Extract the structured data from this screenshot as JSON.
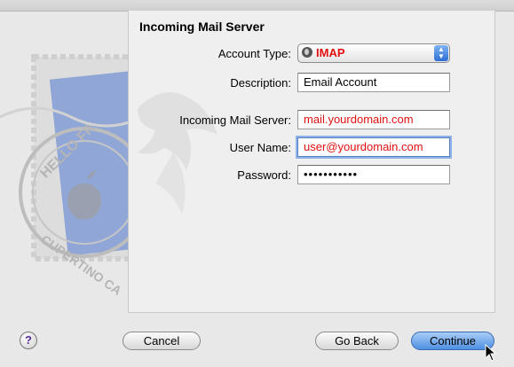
{
  "panel": {
    "title": "Incoming Mail Server"
  },
  "form": {
    "account_type": {
      "label": "Account Type:",
      "value": "IMAP"
    },
    "description": {
      "label": "Description:",
      "value": "Email Account"
    },
    "incoming_server": {
      "label": "Incoming Mail Server:",
      "value": "mail.yourdomain.com"
    },
    "user_name": {
      "label": "User Name:",
      "value": "user@yourdomain.com"
    },
    "password": {
      "label": "Password:",
      "value": "•••••••••••"
    }
  },
  "buttons": {
    "help": "?",
    "cancel": "Cancel",
    "go_back": "Go Back",
    "continue": "Continue"
  },
  "art": {
    "stamp_text_top": "HELLO FR",
    "stamp_text_bottom": "CUPERTINO CA"
  },
  "colors": {
    "value_red": "#e01010",
    "accent_blue": "#4f8fe2"
  }
}
